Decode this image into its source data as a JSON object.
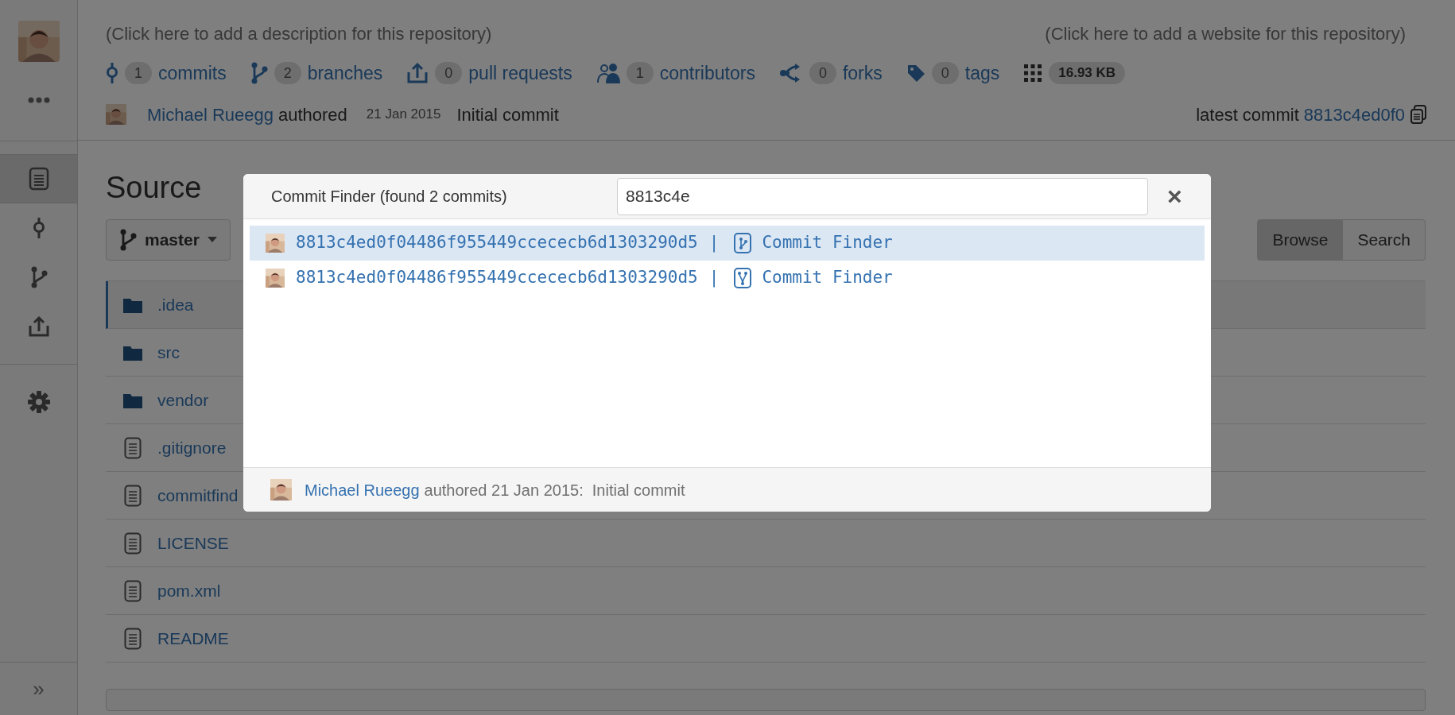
{
  "sidebar": {
    "nav": [
      {
        "kind": "source",
        "selected": true
      },
      {
        "kind": "commits",
        "selected": false
      },
      {
        "kind": "branches",
        "selected": false
      },
      {
        "kind": "pull_requests",
        "selected": false
      }
    ],
    "tools": [
      {
        "kind": "settings",
        "selected": false
      }
    ],
    "expand": "»"
  },
  "repository": {
    "description": "(Click here to add a description for this repository)",
    "website": "(Click here to add a website for this repository)",
    "stats": [
      {
        "kind": "commits",
        "count": "1",
        "label": "commits"
      },
      {
        "kind": "branches",
        "count": "2",
        "label": "branches"
      },
      {
        "kind": "pull_requests",
        "count": "0",
        "label": "pull requests"
      },
      {
        "kind": "contributors",
        "count": "1",
        "label": "contributors"
      },
      {
        "kind": "forks",
        "count": "0",
        "label": "forks"
      },
      {
        "kind": "tags",
        "count": "0",
        "label": "tags"
      },
      {
        "kind": "size",
        "count": "16.93 KB"
      }
    ],
    "last_commit": {
      "author": "Michael Rueegg",
      "verb": "authored",
      "date": "21 Jan 2015",
      "message": "Initial commit",
      "latest_label": "latest commit",
      "hash": "8813c4ed0f0"
    }
  },
  "source": {
    "title": "Source",
    "branch": "master",
    "view_buttons": [
      {
        "label": "Browse",
        "selected": true
      },
      {
        "label": "Search",
        "selected": false
      }
    ],
    "files": [
      {
        "kind": "folder",
        "name": ".idea",
        "selected": true
      },
      {
        "kind": "folder",
        "name": "src",
        "selected": false
      },
      {
        "kind": "folder",
        "name": "vendor",
        "selected": false
      },
      {
        "kind": "file",
        "name": ".gitignore",
        "selected": false
      },
      {
        "kind": "file",
        "name": "commitfind",
        "selected": false
      },
      {
        "kind": "file",
        "name": "LICENSE",
        "selected": false
      },
      {
        "kind": "file",
        "name": "pom.xml",
        "selected": false
      },
      {
        "kind": "file",
        "name": "README",
        "selected": false
      }
    ]
  },
  "dialog": {
    "title": "Commit Finder (found 2 commits)",
    "query": "8813c4e",
    "close": "×",
    "results": [
      {
        "kind": "source",
        "hash": "8813c4ed0f04486f955449ccececb6d1303290d5",
        "separator": "|",
        "repository": "Commit Finder",
        "selected": true
      },
      {
        "kind": "fork",
        "hash": "8813c4ed0f04486f955449ccececb6d1303290d5",
        "separator": "|",
        "repository": "Commit Finder",
        "selected": false
      }
    ],
    "footer": {
      "author": "Michael Rueegg",
      "text": "authored 21 Jan 2015:  Initial commit"
    }
  }
}
